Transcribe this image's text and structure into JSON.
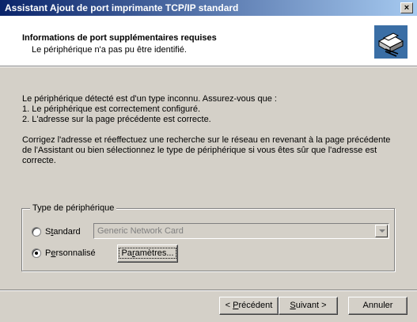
{
  "window": {
    "title": "Assistant Ajout de port imprimante TCP/IP standard",
    "close_label": "×"
  },
  "header": {
    "title": "Informations de port supplémentaires requises",
    "subtitle": "Le périphérique n'a pas pu être identifié.",
    "icon": "printer-port-icon"
  },
  "body": {
    "line1": "Le périphérique détecté est d'un type inconnu. Assurez-vous que :",
    "line2": "1. Le périphérique est correctement configuré.",
    "line3": "2.  L'adresse sur la page précédente est correcte.",
    "para2_line1": "Corrigez l'adresse et réeffectuez une recherche sur le réseau en revenant à la page précédente",
    "para2_line2": "de l'Assistant ou bien sélectionnez le type de périphérique si vous êtes sûr que l'adresse est",
    "para2_line3": "correcte."
  },
  "device_type": {
    "legend": "Type de périphérique",
    "standard": {
      "pre": "S",
      "key": "t",
      "post": "andard",
      "selected": false
    },
    "standard_value": "Generic Network Card",
    "custom": {
      "pre": "P",
      "key": "e",
      "post": "rsonnalisé",
      "selected": true
    },
    "settings_button": {
      "pre": "Pa",
      "key": "r",
      "post": "amètres..."
    }
  },
  "footer": {
    "back": {
      "pre": "< ",
      "key": "P",
      "post": "récédent"
    },
    "next": {
      "pre": "",
      "key": "S",
      "post": "uivant >"
    },
    "cancel": "Annuler"
  }
}
